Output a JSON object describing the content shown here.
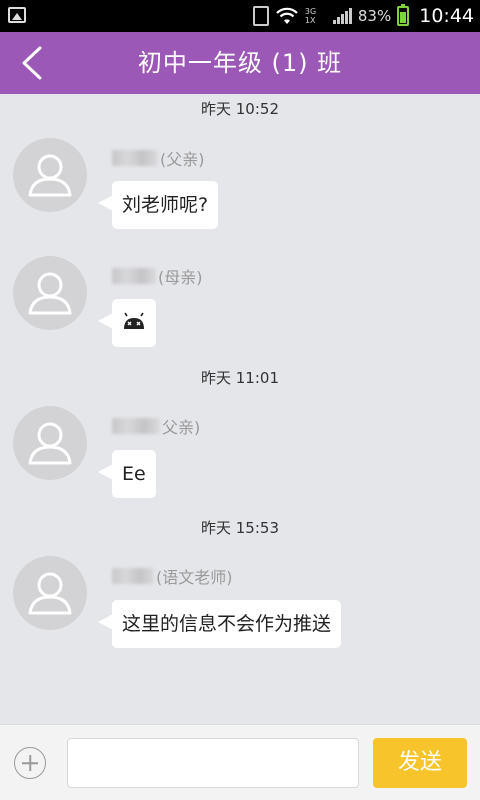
{
  "status_bar": {
    "network_type": "3G",
    "network_sub": "1X",
    "battery_percent": "83%",
    "time": "10:44",
    "icons": [
      "image-notification-icon",
      "sim-icon",
      "wifi-icon",
      "signal-icon",
      "battery-icon"
    ],
    "battery_color": "#7fd23b"
  },
  "header": {
    "title": "初中一年级 (1) 班",
    "back_icon": "chevron-left-icon",
    "color": "#9b58b6"
  },
  "chat": {
    "timestamps": [
      "昨天 10:52",
      "昨天 11:01",
      "昨天 15:53"
    ],
    "messages": [
      {
        "sender_role": "(父亲)",
        "text": "刘老师呢?"
      },
      {
        "sender_role": "(母亲)",
        "icon": "android-robot-icon"
      },
      {
        "sender_role": "父亲)",
        "text": "Ee"
      },
      {
        "sender_role": "(语文老师)",
        "text": "这里的信息不会作为推送"
      }
    ]
  },
  "input_bar": {
    "plus_icon": "plus-circle-icon",
    "input_value": "",
    "send_label": "发送",
    "send_color": "#f7c52b"
  }
}
